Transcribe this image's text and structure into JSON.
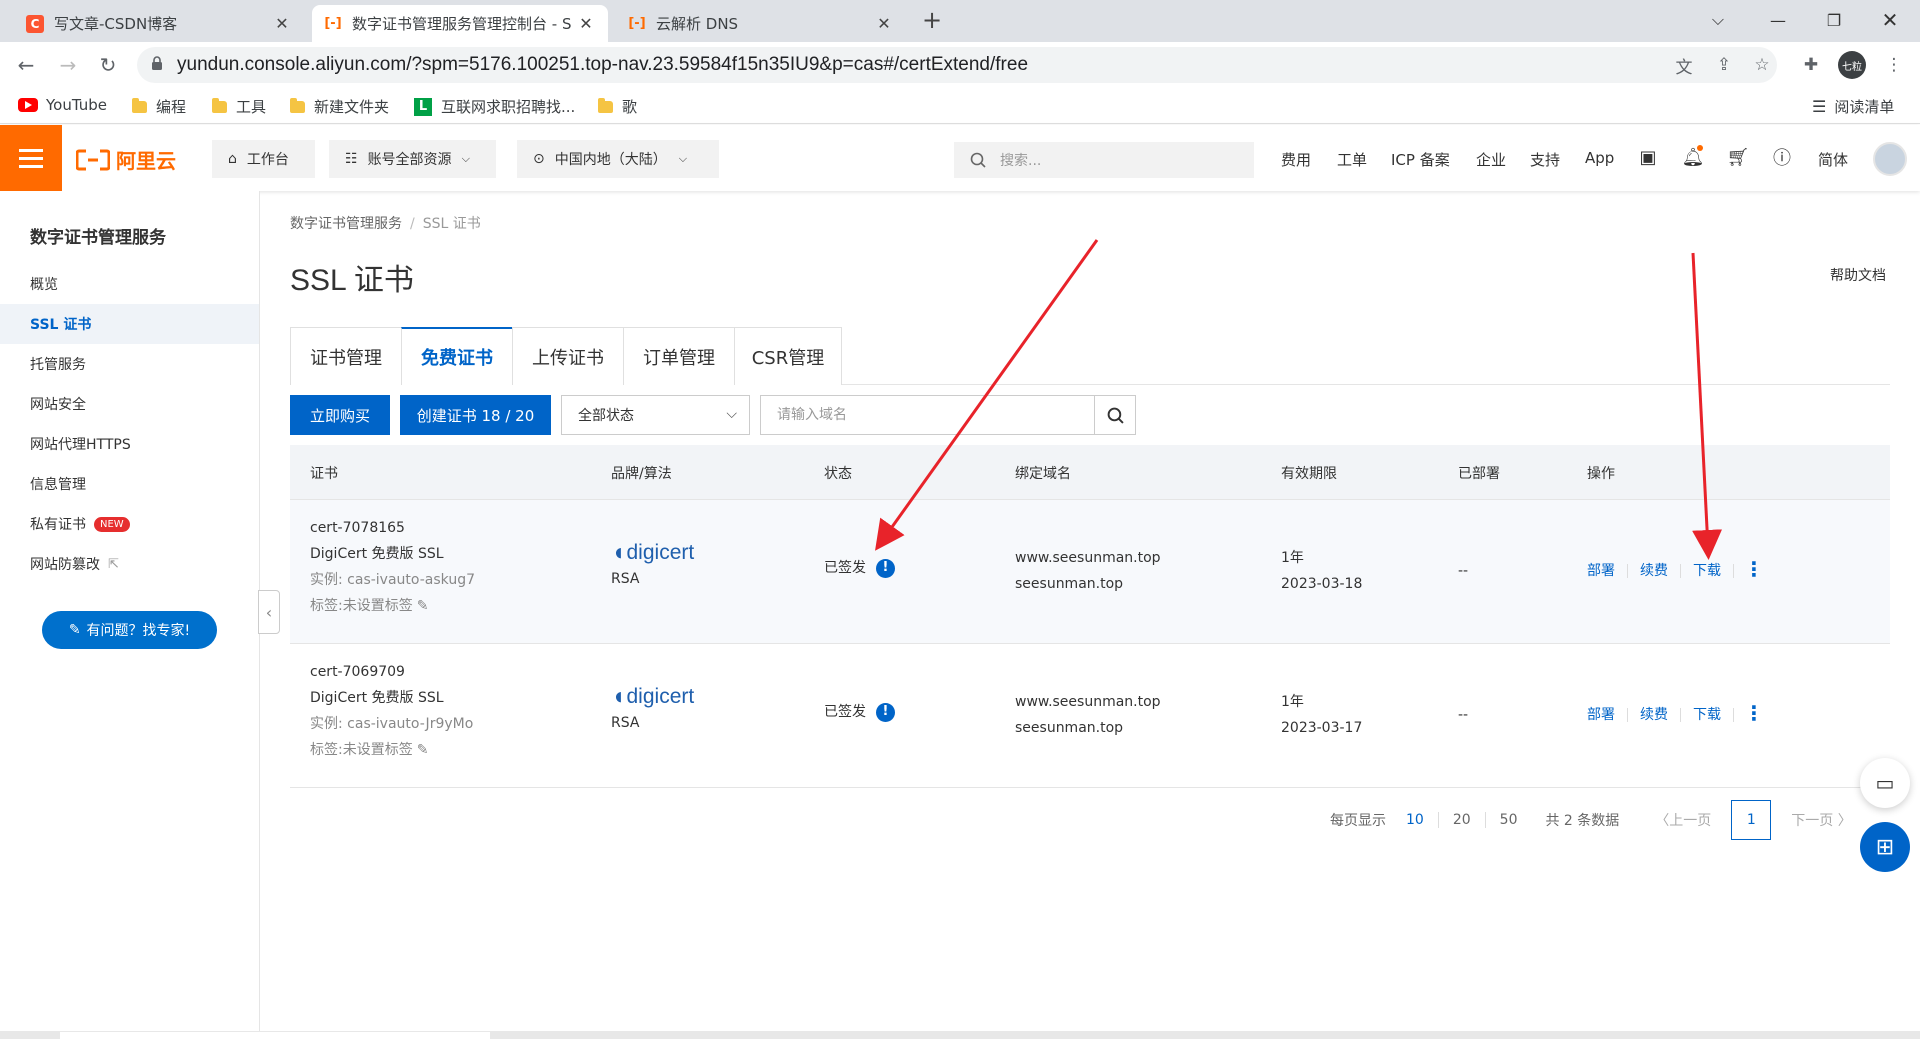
{
  "browser": {
    "tabs": [
      {
        "title": "写文章-CSDN博客",
        "favicon": "C",
        "favicon_color": "#fc5531"
      },
      {
        "title": "数字证书管理服务管理控制台 - S",
        "favicon": "[-]",
        "favicon_color": "#ff6a00"
      },
      {
        "title": "云解析 DNS",
        "favicon": "[-]",
        "favicon_color": "#ff6a00"
      }
    ],
    "url": "yundun.console.aliyun.com/?spm=5176.100251.top-nav.23.59584f15n35IU9&p=cas#/certExtend/free",
    "profile_label": "七粒",
    "bookmarks": [
      "YouTube",
      "编程",
      "工具",
      "新建文件夹",
      "互联网求职招聘找...",
      "歌"
    ],
    "reading_list": "阅读清单"
  },
  "topbar": {
    "logo_text": "阿里云",
    "workbench": "工作台",
    "resources": "账号全部资源",
    "region": "中国内地（大陆）",
    "search_placeholder": "搜索...",
    "links": [
      "费用",
      "工单",
      "ICP 备案",
      "企业",
      "支持",
      "App"
    ],
    "lang": "简体"
  },
  "sidebar": {
    "title": "数字证书管理服务",
    "items": [
      {
        "label": "概览"
      },
      {
        "label": "SSL 证书",
        "active": true
      },
      {
        "label": "托管服务"
      },
      {
        "label": "网站安全"
      },
      {
        "label": "网站代理HTTPS"
      },
      {
        "label": "信息管理"
      },
      {
        "label": "私有证书",
        "badge": "NEW"
      },
      {
        "label": "网站防篡改"
      }
    ],
    "help_button": "有问题？找专家!"
  },
  "main": {
    "breadcrumb": [
      "数字证书管理服务",
      "SSL 证书"
    ],
    "title": "SSL 证书",
    "help_doc": "帮助文档",
    "tabs": [
      "证书管理",
      "免费证书",
      "上传证书",
      "订单管理",
      "CSR管理"
    ],
    "active_tab": "免费证书",
    "buy_button": "立即购买",
    "create_button": "创建证书 18 / 20",
    "status_select": "全部状态",
    "domain_placeholder": "请输入域名",
    "columns": [
      "证书",
      "品牌/算法",
      "状态",
      "绑定域名",
      "有效期限",
      "已部署",
      "操作"
    ],
    "rows": [
      {
        "cert_name": "cert-7078165",
        "cert_type": "DigiCert 免费版 SSL",
        "instance": "实例: cas-ivauto-askug7",
        "tag": "标签:未设置标签",
        "brand": "digicert",
        "algorithm": "RSA",
        "status": "已签发",
        "domain1": "www.seesunman.top",
        "domain2": "seesunman.top",
        "period": "1年",
        "expire": "2023-03-18",
        "deployed": "--",
        "op_deploy": "部署",
        "op_renew": "续费",
        "op_download": "下载"
      },
      {
        "cert_name": "cert-7069709",
        "cert_type": "DigiCert 免费版 SSL",
        "instance": "实例: cas-ivauto-Jr9yMo",
        "tag": "标签:未设置标签",
        "brand": "digicert",
        "algorithm": "RSA",
        "status": "已签发",
        "domain1": "www.seesunman.top",
        "domain2": "seesunman.top",
        "period": "1年",
        "expire": "2023-03-17",
        "deployed": "--",
        "op_deploy": "部署",
        "op_renew": "续费",
        "op_download": "下载"
      }
    ],
    "pager": {
      "per_page_label": "每页显示",
      "sizes": [
        "10",
        "20",
        "50"
      ],
      "total": "共 2 条数据",
      "prev": "〈上一页",
      "current": "1",
      "next": "下一页 〉"
    }
  },
  "colors": {
    "accent": "#0064c8",
    "brand": "#ff6a00",
    "annotation_arrow": "#e8232a"
  }
}
